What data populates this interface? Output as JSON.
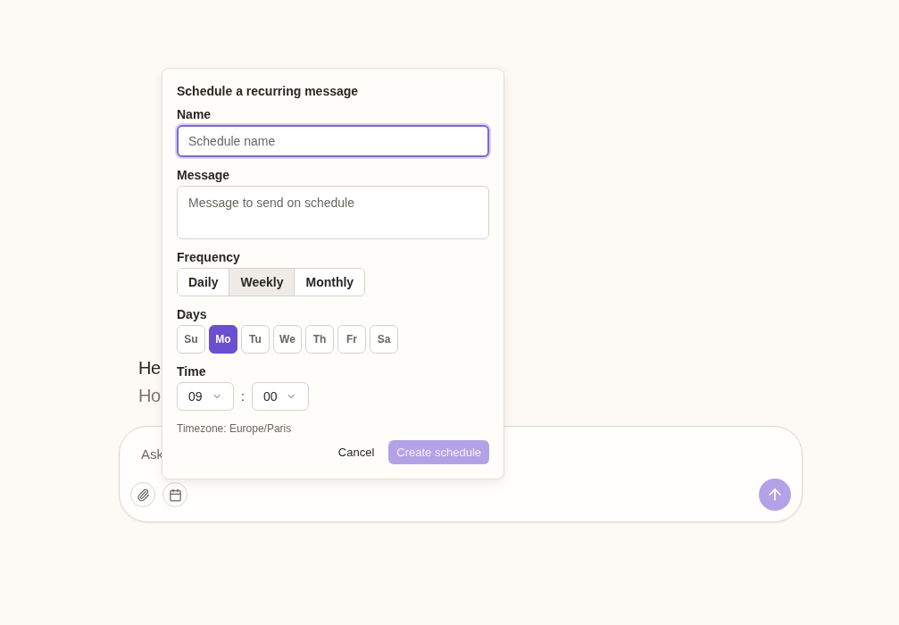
{
  "background": {
    "heading": "He",
    "subheading": "Ho",
    "composer": {
      "placeholder": "Ask"
    }
  },
  "popover": {
    "title": "Schedule a recurring message",
    "name": {
      "label": "Name",
      "placeholder": "Schedule name",
      "focused": true
    },
    "message": {
      "label": "Message",
      "placeholder": "Message to send on schedule"
    },
    "frequency": {
      "label": "Frequency",
      "options": [
        {
          "label": "Daily",
          "selected": false
        },
        {
          "label": "Weekly",
          "selected": true
        },
        {
          "label": "Monthly",
          "selected": false
        }
      ]
    },
    "days": {
      "label": "Days",
      "items": [
        {
          "label": "Su",
          "selected": false
        },
        {
          "label": "Mo",
          "selected": true
        },
        {
          "label": "Tu",
          "selected": false
        },
        {
          "label": "We",
          "selected": false
        },
        {
          "label": "Th",
          "selected": false
        },
        {
          "label": "Fr",
          "selected": false
        },
        {
          "label": "Sa",
          "selected": false
        }
      ]
    },
    "time": {
      "label": "Time",
      "hour": "09",
      "separator": ":",
      "minute": "00"
    },
    "timezone": "Timezone: Europe/Paris",
    "buttons": {
      "cancel": "Cancel",
      "create": {
        "label": "Create schedule",
        "disabled": true
      }
    }
  }
}
